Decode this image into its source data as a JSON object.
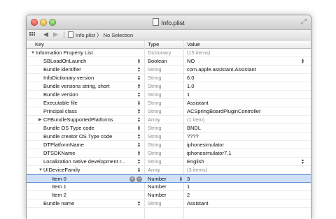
{
  "window": {
    "title": "Info.plist"
  },
  "navbar": {
    "back_label": "◀",
    "forward_label": "▶",
    "breadcrumb_file": "Info.plist",
    "breadcrumb_sep": "〉",
    "breadcrumb_selection": "No Selection"
  },
  "columns": {
    "key": "Key",
    "type": "Type",
    "value": "Value"
  },
  "rows": [
    {
      "key": "Information Property List",
      "type": "Dictionary",
      "value": "(15 items)"
    },
    {
      "key": "SBLoadOnLaunch",
      "type": "Boolean",
      "value": "NO"
    },
    {
      "key": "Bundle identifier",
      "type": "String",
      "value": "com.apple.assistant.Assistant"
    },
    {
      "key": "InfoDictionary version",
      "type": "String",
      "value": "6.0"
    },
    {
      "key": "Bundle versions string, short",
      "type": "String",
      "value": "1.0"
    },
    {
      "key": "Bundle version",
      "type": "String",
      "value": "1"
    },
    {
      "key": "Executable file",
      "type": "String",
      "value": "Assistant"
    },
    {
      "key": "Principal class",
      "type": "String",
      "value": "ACSpringBoardPluginController"
    },
    {
      "key": "CFBundleSupportedPlatforms",
      "type": "Array",
      "value": "(1 item)"
    },
    {
      "key": "Bundle OS Type code",
      "type": "String",
      "value": "BNDL"
    },
    {
      "key": "Bundle creator OS Type code",
      "type": "String",
      "value": "????"
    },
    {
      "key": "DTPlatformName",
      "type": "String",
      "value": "iphonesimulator"
    },
    {
      "key": "DTSDKName",
      "type": "String",
      "value": "iphonesimulator7.1"
    },
    {
      "key": "Localization native development r...",
      "type": "String",
      "value": "English"
    },
    {
      "key": "UIDeviceFamily",
      "type": "Array",
      "value": "(3 items)"
    },
    {
      "key": "Item 0",
      "type": "Number",
      "value": "3"
    },
    {
      "key": "Item 1",
      "type": "Number",
      "value": "1"
    },
    {
      "key": "Item 2",
      "type": "Number",
      "value": "2"
    },
    {
      "key": "Bundle name",
      "type": "String",
      "value": "Assistant"
    }
  ],
  "colors": {
    "selection": "#cfe0f7",
    "selection_border": "#5a8ed8"
  }
}
